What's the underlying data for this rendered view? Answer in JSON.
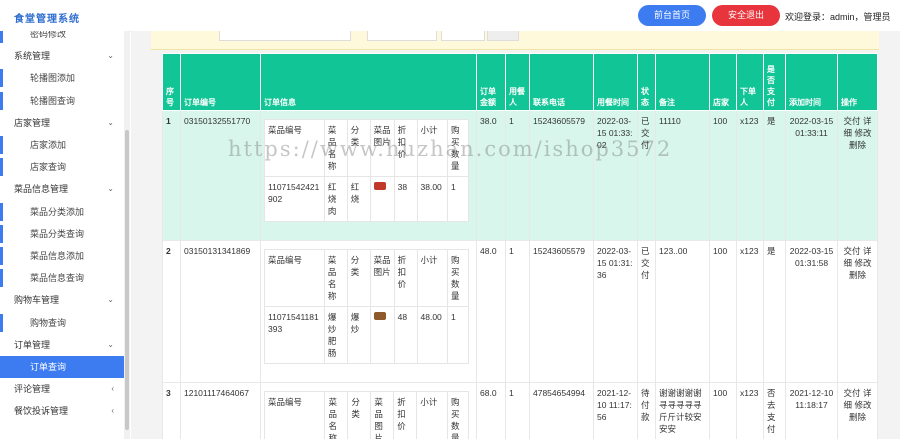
{
  "brand": "食堂管理系统",
  "header": {
    "home_label": "前台首页",
    "logout_label": "安全退出",
    "welcome": "欢迎登录：admin，管理员"
  },
  "sidebar": {
    "items": [
      {
        "type": "sub",
        "label": "密码修改"
      },
      {
        "type": "group",
        "label": "系统管理",
        "arrow": "⌄"
      },
      {
        "type": "sub",
        "label": "轮播图添加"
      },
      {
        "type": "sub",
        "label": "轮播图查询"
      },
      {
        "type": "group",
        "label": "店家管理",
        "arrow": "⌄"
      },
      {
        "type": "sub",
        "label": "店家添加"
      },
      {
        "type": "sub",
        "label": "店家查询"
      },
      {
        "type": "group",
        "label": "菜品信息管理",
        "arrow": "⌄"
      },
      {
        "type": "sub",
        "label": "菜品分类添加"
      },
      {
        "type": "sub",
        "label": "菜品分类查询"
      },
      {
        "type": "sub",
        "label": "菜品信息添加"
      },
      {
        "type": "sub",
        "label": "菜品信息查询"
      },
      {
        "type": "group",
        "label": "购物车管理",
        "arrow": "⌄"
      },
      {
        "type": "sub",
        "label": "购物查询"
      },
      {
        "type": "group",
        "label": "订单管理",
        "arrow": "⌄"
      },
      {
        "type": "sub",
        "label": "订单查询",
        "active": true
      },
      {
        "type": "group",
        "label": "评论管理",
        "arrow": "‹"
      },
      {
        "type": "group",
        "label": "餐饮投诉管理",
        "arrow": "‹"
      }
    ]
  },
  "table": {
    "headers": [
      "序号",
      "订单编号",
      "订单信息",
      "订单金额",
      "用餐人",
      "联系电话",
      "用餐时间",
      "状态",
      "备注",
      "店家",
      "下单人",
      "是否支付",
      "添加时间",
      "操作"
    ],
    "inner_headers": [
      "菜品编号",
      "菜品名称",
      "分类",
      "菜品图片",
      "折扣价",
      "小计",
      "购买数量"
    ],
    "rows": [
      {
        "no": "1",
        "order_no": "03150132551770",
        "amount": "38.0",
        "diners": "1",
        "phone": "15243605579",
        "dine_time": "2022-03-15 01:33:02",
        "status": "已交付",
        "remark": "11110",
        "shop": "100",
        "user": "x123",
        "paid": "是",
        "added": "2022-03-15 01:33:11",
        "actions": [
          "交付",
          "详细",
          "修改",
          "删除"
        ],
        "items": [
          {
            "code": "11071542421902",
            "name": "红烧肉",
            "category": "红烧",
            "img": "#c0392b",
            "price": "38",
            "subtotal": "38.00",
            "qty": "1"
          }
        ]
      },
      {
        "no": "2",
        "order_no": "03150131341869",
        "amount": "48.0",
        "diners": "1",
        "phone": "15243605579",
        "dine_time": "2022-03-15 01:31:36",
        "status": "已交付",
        "remark": "123..00",
        "shop": "100",
        "user": "x123",
        "paid": "是",
        "added": "2022-03-15 01:31:58",
        "actions": [
          "交付",
          "详细",
          "修改",
          "删除"
        ],
        "items": [
          {
            "code": "11071541181393",
            "name": "爆炒肥肠",
            "category": "爆炒",
            "img": "#8e5a2b",
            "price": "48",
            "subtotal": "48.00",
            "qty": "1"
          }
        ]
      },
      {
        "no": "3",
        "order_no": "12101117464067",
        "amount": "68.0",
        "diners": "1",
        "phone": "47854654994",
        "dine_time": "2021-12-10 11:17:56",
        "status": "待付款",
        "remark": "谢谢谢谢谢寻寻寻寻寻斤斤计较安安安",
        "shop": "100",
        "user": "x123",
        "paid": "否去支付",
        "added": "2021-12-10 11:18:17",
        "actions": [
          "交付",
          "详细",
          "修改",
          "删除"
        ],
        "items": []
      }
    ]
  },
  "watermark": "https://www.huzhan.com/ishop3572",
  "colors": {
    "header_green": "#12c596",
    "accent_blue": "#3d7cf0",
    "logout_red": "#e8343c",
    "highlight_row": "#d8f6ec"
  }
}
